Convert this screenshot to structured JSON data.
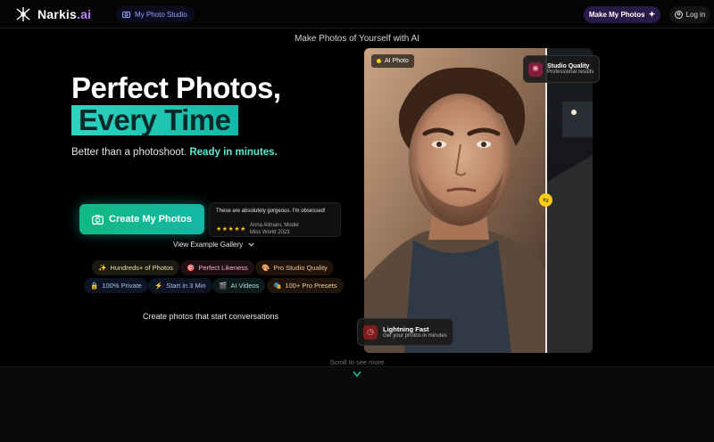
{
  "nav": {
    "brand_name": "Narkis",
    "brand_suffix": ".ai",
    "studio_link": "My Photo Studio",
    "make_button": "Make My Photos",
    "login_button": "Log in"
  },
  "hero": {
    "tagline": "Make Photos of Yourself with AI",
    "title_line1": "Perfect Photos,",
    "title_line2": "Every Time",
    "subtitle_prefix": "Better than a photoshoot.",
    "subtitle_highlight": "Ready in minutes.",
    "cta_label": "Create My Photos",
    "gallery_link": "View Example Gallery",
    "conversation_line": "Create photos that start conversations"
  },
  "testimonial": {
    "quote": "These are absolutely gorgeous. I'm obsessed!",
    "stars": "★★★★★",
    "author": "Anna Alimani, Model",
    "role": "Miss World 2023"
  },
  "badges": [
    {
      "icon": "sparkles",
      "label": "Hundreds+ of Photos",
      "bg": "#1a1a10",
      "color": "#e9e3a0"
    },
    {
      "icon": "target",
      "label": "Perfect Likeness",
      "bg": "#1f0f14",
      "color": "#f5b4c4"
    },
    {
      "icon": "palette",
      "label": "Pro Studio Quality",
      "bg": "#1f130a",
      "color": "#f0c49a"
    },
    {
      "icon": "lock",
      "label": "100% Private",
      "bg": "#0d1424",
      "color": "#a5c4f5"
    },
    {
      "icon": "lightning",
      "label": "Start in 3 Min",
      "bg": "#0d1424",
      "color": "#a5c4f5"
    },
    {
      "icon": "film",
      "label": "AI Videos",
      "bg": "#0d1a1a",
      "color": "#a5e0d8"
    },
    {
      "icon": "theater-masks",
      "label": "100+ Pro Presets",
      "bg": "#1f150a",
      "color": "#f0d09a"
    }
  ],
  "photo_card": {
    "ai_tag": "AI Photo",
    "quality_title": "Studio Quality",
    "quality_sub": "Professional results",
    "fast_title": "Lightning Fast",
    "fast_sub": "Get your photos in minutes"
  },
  "scroll_hint": "Scroll to see more",
  "colors": {
    "accent_teal": "#14b8a6",
    "accent_purple": "#c084fc",
    "highlight": "#5eead4"
  }
}
